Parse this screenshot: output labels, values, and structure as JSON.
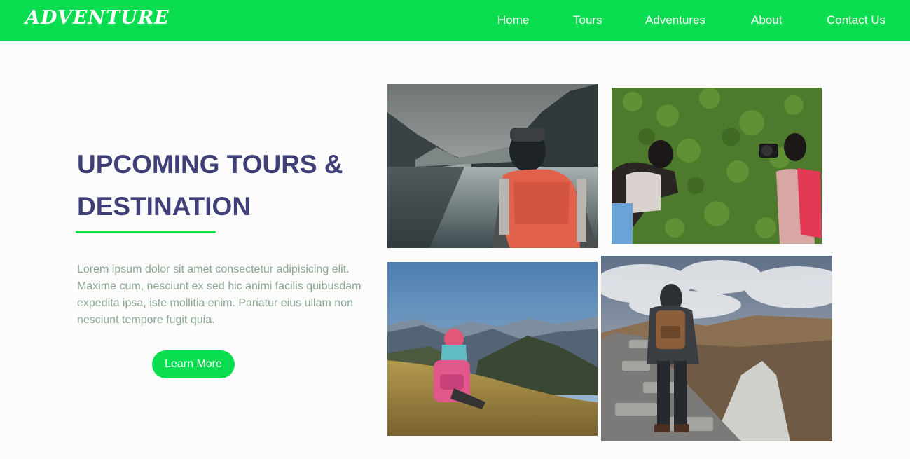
{
  "header": {
    "logo": "ADVENTURE",
    "nav": [
      "Home",
      "Tours",
      "Adventures",
      "About",
      "Contact Us"
    ]
  },
  "hero": {
    "title_line1": "UPCOMING TOURS &",
    "title_line2": "DESTINATION",
    "text": "Lorem ipsum dolor sit amet consectetur adipisicing elit. Maxime cum, nesciunt ex sed hic animi facilis quibusdam expedita ipsa, iste mollitia enim. Pariatur eius ullam non nesciunt tempore fugit quia.",
    "button_label": "Learn More"
  },
  "colors": {
    "accent": "#0add4f",
    "title": "#3f4078",
    "body_text": "#8aa78f"
  }
}
